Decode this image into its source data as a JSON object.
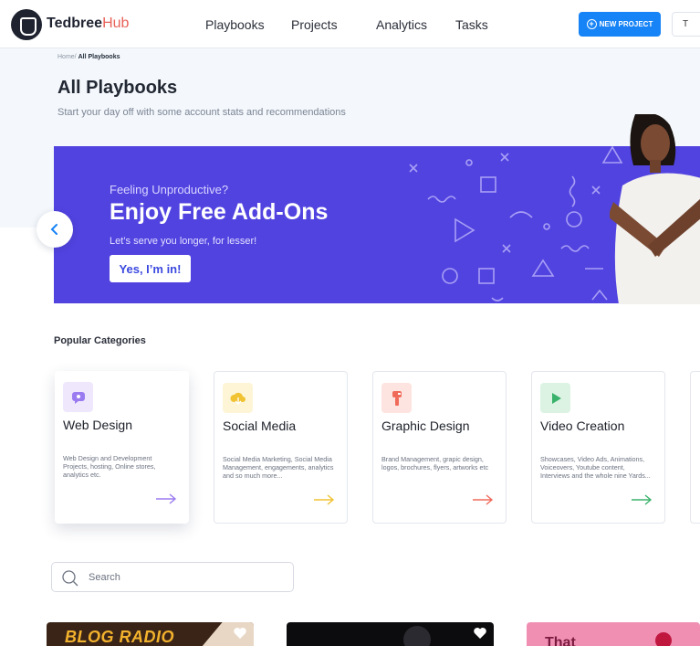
{
  "brand": {
    "name": "Tedbree",
    "suffix": "Hub"
  },
  "nav": {
    "playbooks": "Playbooks",
    "projects": "Projects",
    "analytics": "Analytics",
    "tasks": "Tasks"
  },
  "header_actions": {
    "new_project": "NEW PROJECT",
    "partial_button": "T"
  },
  "breadcrumb": {
    "home": "Home/",
    "current": "All Playbooks"
  },
  "page": {
    "title": "All Playbooks",
    "subtitle": "Start your day off with some account stats and recommendations"
  },
  "banner": {
    "kicker": "Feeling Unproductive?",
    "title": "Enjoy Free Add-Ons",
    "subtitle": "Let’s serve you longer, for lesser!",
    "cta": "Yes, I’m in!"
  },
  "categories": {
    "heading": "Popular Categories",
    "items": [
      {
        "title": "Web Design",
        "description": "Web Design and Development Projects, hosting, Online stores, analytics etc.",
        "icon": "chat-icon",
        "accent": "#9b7bf0"
      },
      {
        "title": "Social Media",
        "description": "Social Media Marketing, Social Media Management, engagements, analytics and so much more...",
        "icon": "cloud-icon",
        "accent": "#f1c232"
      },
      {
        "title": "Graphic Design",
        "description": "Brand Management, grapic design, logos, brochures, flyers, artworks etc",
        "icon": "brush-icon",
        "accent": "#f06a5a"
      },
      {
        "title": "Video Creation",
        "description": "Showcases, Video Ads, Animations, Voiceovers, Youtube content, Interviews and the whole nine Yards...",
        "icon": "play-icon",
        "accent": "#3bb26b"
      }
    ]
  },
  "search": {
    "placeholder": "Search"
  },
  "thumbnails": [
    {
      "text": "BLOG RADIO"
    },
    {
      "text": ""
    },
    {
      "text": "That"
    }
  ],
  "colors": {
    "primary": "#1683f6",
    "banner": "#5143e0"
  }
}
